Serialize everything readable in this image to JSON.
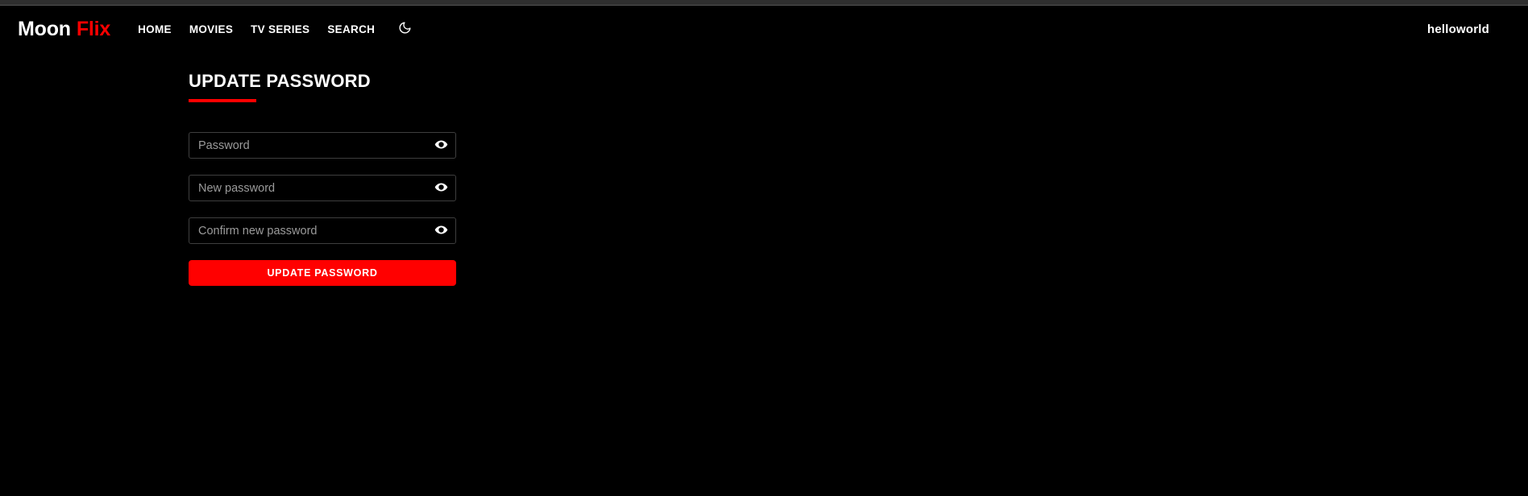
{
  "theme": {
    "background": "#000000",
    "accent": "#ff0000",
    "text": "#ffffff",
    "placeholder": "#9b9b9b",
    "input_border": "#3e3e3e",
    "top_strip": "#2f2f2f"
  },
  "header": {
    "brand": {
      "first": "Moon",
      "second": "Flix"
    },
    "nav": [
      {
        "label": "HOME"
      },
      {
        "label": "MOVIES"
      },
      {
        "label": "TV SERIES"
      },
      {
        "label": "SEARCH"
      }
    ],
    "theme_toggle_icon": "moon-icon",
    "user_name": "helloworld"
  },
  "main": {
    "title": "UPDATE PASSWORD",
    "fields": [
      {
        "name": "current-password",
        "placeholder": "Password",
        "value": "",
        "toggle_icon": "eye-icon"
      },
      {
        "name": "new-password",
        "placeholder": "New password",
        "value": "",
        "toggle_icon": "eye-icon"
      },
      {
        "name": "confirm-new-password",
        "placeholder": "Confirm new password",
        "value": "",
        "toggle_icon": "eye-icon"
      }
    ],
    "submit_label": "UPDATE PASSWORD"
  }
}
